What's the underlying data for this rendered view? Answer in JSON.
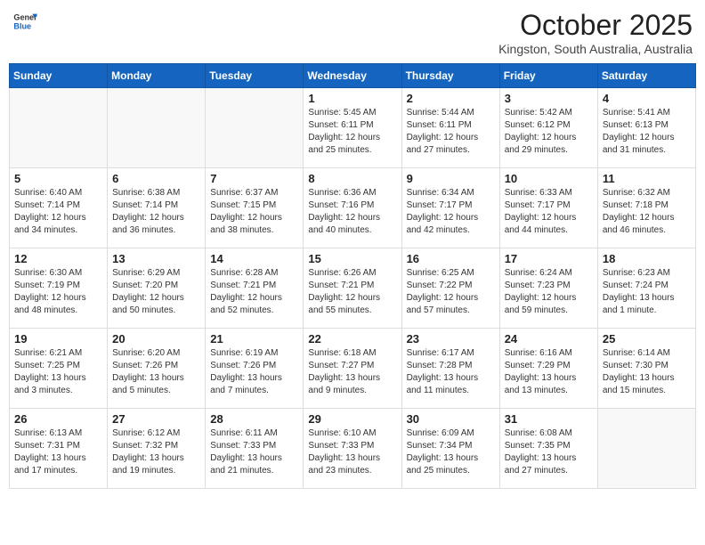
{
  "header": {
    "logo_general": "General",
    "logo_blue": "Blue",
    "month": "October 2025",
    "location": "Kingston, South Australia, Australia"
  },
  "weekdays": [
    "Sunday",
    "Monday",
    "Tuesday",
    "Wednesday",
    "Thursday",
    "Friday",
    "Saturday"
  ],
  "weeks": [
    [
      {
        "day": "",
        "info": ""
      },
      {
        "day": "",
        "info": ""
      },
      {
        "day": "",
        "info": ""
      },
      {
        "day": "1",
        "info": "Sunrise: 5:45 AM\nSunset: 6:11 PM\nDaylight: 12 hours\nand 25 minutes."
      },
      {
        "day": "2",
        "info": "Sunrise: 5:44 AM\nSunset: 6:11 PM\nDaylight: 12 hours\nand 27 minutes."
      },
      {
        "day": "3",
        "info": "Sunrise: 5:42 AM\nSunset: 6:12 PM\nDaylight: 12 hours\nand 29 minutes."
      },
      {
        "day": "4",
        "info": "Sunrise: 5:41 AM\nSunset: 6:13 PM\nDaylight: 12 hours\nand 31 minutes."
      }
    ],
    [
      {
        "day": "5",
        "info": "Sunrise: 6:40 AM\nSunset: 7:14 PM\nDaylight: 12 hours\nand 34 minutes."
      },
      {
        "day": "6",
        "info": "Sunrise: 6:38 AM\nSunset: 7:14 PM\nDaylight: 12 hours\nand 36 minutes."
      },
      {
        "day": "7",
        "info": "Sunrise: 6:37 AM\nSunset: 7:15 PM\nDaylight: 12 hours\nand 38 minutes."
      },
      {
        "day": "8",
        "info": "Sunrise: 6:36 AM\nSunset: 7:16 PM\nDaylight: 12 hours\nand 40 minutes."
      },
      {
        "day": "9",
        "info": "Sunrise: 6:34 AM\nSunset: 7:17 PM\nDaylight: 12 hours\nand 42 minutes."
      },
      {
        "day": "10",
        "info": "Sunrise: 6:33 AM\nSunset: 7:17 PM\nDaylight: 12 hours\nand 44 minutes."
      },
      {
        "day": "11",
        "info": "Sunrise: 6:32 AM\nSunset: 7:18 PM\nDaylight: 12 hours\nand 46 minutes."
      }
    ],
    [
      {
        "day": "12",
        "info": "Sunrise: 6:30 AM\nSunset: 7:19 PM\nDaylight: 12 hours\nand 48 minutes."
      },
      {
        "day": "13",
        "info": "Sunrise: 6:29 AM\nSunset: 7:20 PM\nDaylight: 12 hours\nand 50 minutes."
      },
      {
        "day": "14",
        "info": "Sunrise: 6:28 AM\nSunset: 7:21 PM\nDaylight: 12 hours\nand 52 minutes."
      },
      {
        "day": "15",
        "info": "Sunrise: 6:26 AM\nSunset: 7:21 PM\nDaylight: 12 hours\nand 55 minutes."
      },
      {
        "day": "16",
        "info": "Sunrise: 6:25 AM\nSunset: 7:22 PM\nDaylight: 12 hours\nand 57 minutes."
      },
      {
        "day": "17",
        "info": "Sunrise: 6:24 AM\nSunset: 7:23 PM\nDaylight: 12 hours\nand 59 minutes."
      },
      {
        "day": "18",
        "info": "Sunrise: 6:23 AM\nSunset: 7:24 PM\nDaylight: 13 hours\nand 1 minute."
      }
    ],
    [
      {
        "day": "19",
        "info": "Sunrise: 6:21 AM\nSunset: 7:25 PM\nDaylight: 13 hours\nand 3 minutes."
      },
      {
        "day": "20",
        "info": "Sunrise: 6:20 AM\nSunset: 7:26 PM\nDaylight: 13 hours\nand 5 minutes."
      },
      {
        "day": "21",
        "info": "Sunrise: 6:19 AM\nSunset: 7:26 PM\nDaylight: 13 hours\nand 7 minutes."
      },
      {
        "day": "22",
        "info": "Sunrise: 6:18 AM\nSunset: 7:27 PM\nDaylight: 13 hours\nand 9 minutes."
      },
      {
        "day": "23",
        "info": "Sunrise: 6:17 AM\nSunset: 7:28 PM\nDaylight: 13 hours\nand 11 minutes."
      },
      {
        "day": "24",
        "info": "Sunrise: 6:16 AM\nSunset: 7:29 PM\nDaylight: 13 hours\nand 13 minutes."
      },
      {
        "day": "25",
        "info": "Sunrise: 6:14 AM\nSunset: 7:30 PM\nDaylight: 13 hours\nand 15 minutes."
      }
    ],
    [
      {
        "day": "26",
        "info": "Sunrise: 6:13 AM\nSunset: 7:31 PM\nDaylight: 13 hours\nand 17 minutes."
      },
      {
        "day": "27",
        "info": "Sunrise: 6:12 AM\nSunset: 7:32 PM\nDaylight: 13 hours\nand 19 minutes."
      },
      {
        "day": "28",
        "info": "Sunrise: 6:11 AM\nSunset: 7:33 PM\nDaylight: 13 hours\nand 21 minutes."
      },
      {
        "day": "29",
        "info": "Sunrise: 6:10 AM\nSunset: 7:33 PM\nDaylight: 13 hours\nand 23 minutes."
      },
      {
        "day": "30",
        "info": "Sunrise: 6:09 AM\nSunset: 7:34 PM\nDaylight: 13 hours\nand 25 minutes."
      },
      {
        "day": "31",
        "info": "Sunrise: 6:08 AM\nSunset: 7:35 PM\nDaylight: 13 hours\nand 27 minutes."
      },
      {
        "day": "",
        "info": ""
      }
    ]
  ]
}
